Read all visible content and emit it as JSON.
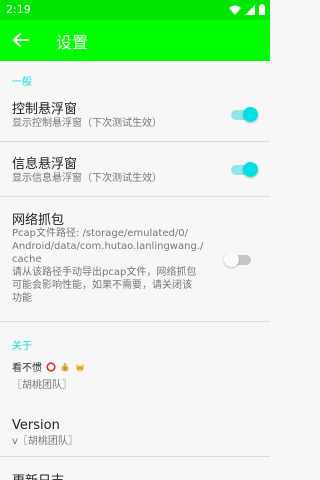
{
  "status_bar": {
    "time": "2:19",
    "icons": [
      "wifi-icon",
      "signal-icon",
      "battery-icon"
    ]
  },
  "app_bar": {
    "back_icon": "arrow-left-icon",
    "title": "设置",
    "color": "#00ff00"
  },
  "sections": {
    "general": {
      "header": "一般"
    },
    "about": {
      "header": "关于"
    }
  },
  "settings": {
    "control_float": {
      "title": "控制悬浮窗",
      "subtitle": "显示控制悬浮窗（下次测试生效）",
      "enabled": true
    },
    "info_float": {
      "title": "信息悬浮窗",
      "subtitle": "显示信息悬浮窗（下次测试生效）",
      "enabled": true
    },
    "packet_capture": {
      "title": "网络抓包",
      "path_line1": "Pcap文件路径: /storage/emulated/0/",
      "path_line2": "Android/data/com.hutao.lanlingwang./",
      "path_line3": "cache",
      "desc_line1": "请从该路径手动导出pcap文件，网络抓包",
      "desc_line2": "可能会影响性能，如果不需要，请关闭该",
      "desc_line3": "功能",
      "enabled": false
    }
  },
  "about": {
    "credits": {
      "title": "看不惯",
      "emojis": [
        "no-entry-circle-icon",
        "money-bag-icon",
        "cat-face-icon"
      ],
      "subtitle": "〖胡桃团队〗"
    },
    "version": {
      "title": "Version",
      "subtitle": "v〖胡桃团队〗"
    },
    "changelog": {
      "title": "更新日志"
    }
  },
  "colors": {
    "accent": "#00dfe6",
    "section_header": "#14d9d9",
    "status_bar": "#00e600"
  }
}
